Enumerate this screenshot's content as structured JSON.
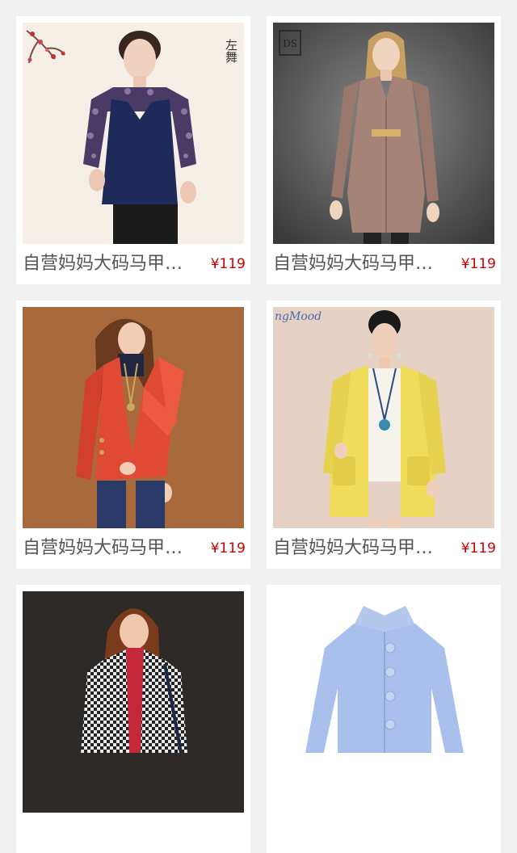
{
  "colors": {
    "page_background": "#f0f0f0",
    "card_background": "#ffffff",
    "title_text": "#555555",
    "price_text": "#cc0000"
  },
  "products": [
    {
      "title": "自营妈妈大码马甲连衣两件套",
      "price": "¥119",
      "image": "woman-navy-vest-floral-blouse",
      "watermark": "左舞"
    },
    {
      "title": "自营妈妈大码马甲连衣两件套",
      "price": "¥119",
      "image": "woman-taupe-wool-coat",
      "watermark": ""
    },
    {
      "title": "自营妈妈大码马甲连衣两件套",
      "price": "¥119",
      "image": "woman-red-wool-coat",
      "watermark": ""
    },
    {
      "title": "自营妈妈大码马甲连衣两件套",
      "price": "¥119",
      "image": "woman-yellow-wool-coat",
      "watermark": "ngMood"
    },
    {
      "title": "",
      "price": "",
      "image": "woman-houndstooth-coat",
      "watermark": ""
    },
    {
      "title": "",
      "price": "",
      "image": "light-blue-wool-coat",
      "watermark": ""
    }
  ]
}
